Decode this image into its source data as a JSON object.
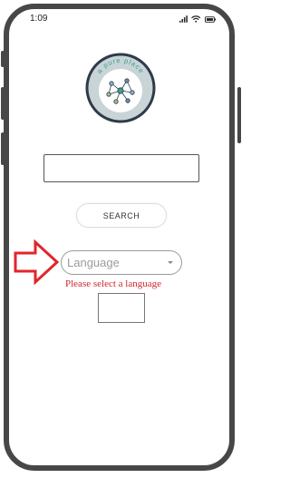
{
  "status_bar": {
    "time": "1:09",
    "icons": [
      "signal-icon",
      "wifi-icon",
      "battery-icon"
    ]
  },
  "logo": {
    "text": "a pure place",
    "ring_color": "#2f3a4a",
    "accent_color": "#3a9e8f",
    "icon": "network-nodes-icon"
  },
  "search": {
    "value": "",
    "placeholder": "",
    "button_label": "SEARCH"
  },
  "language": {
    "selected": "Language",
    "caret_icon": "chevron-down-icon"
  },
  "error": {
    "message": "Please select a language",
    "color": "#d1242f"
  },
  "annotation": {
    "arrow_icon": "arrow-right-icon",
    "arrow_color": "#e0262b"
  }
}
